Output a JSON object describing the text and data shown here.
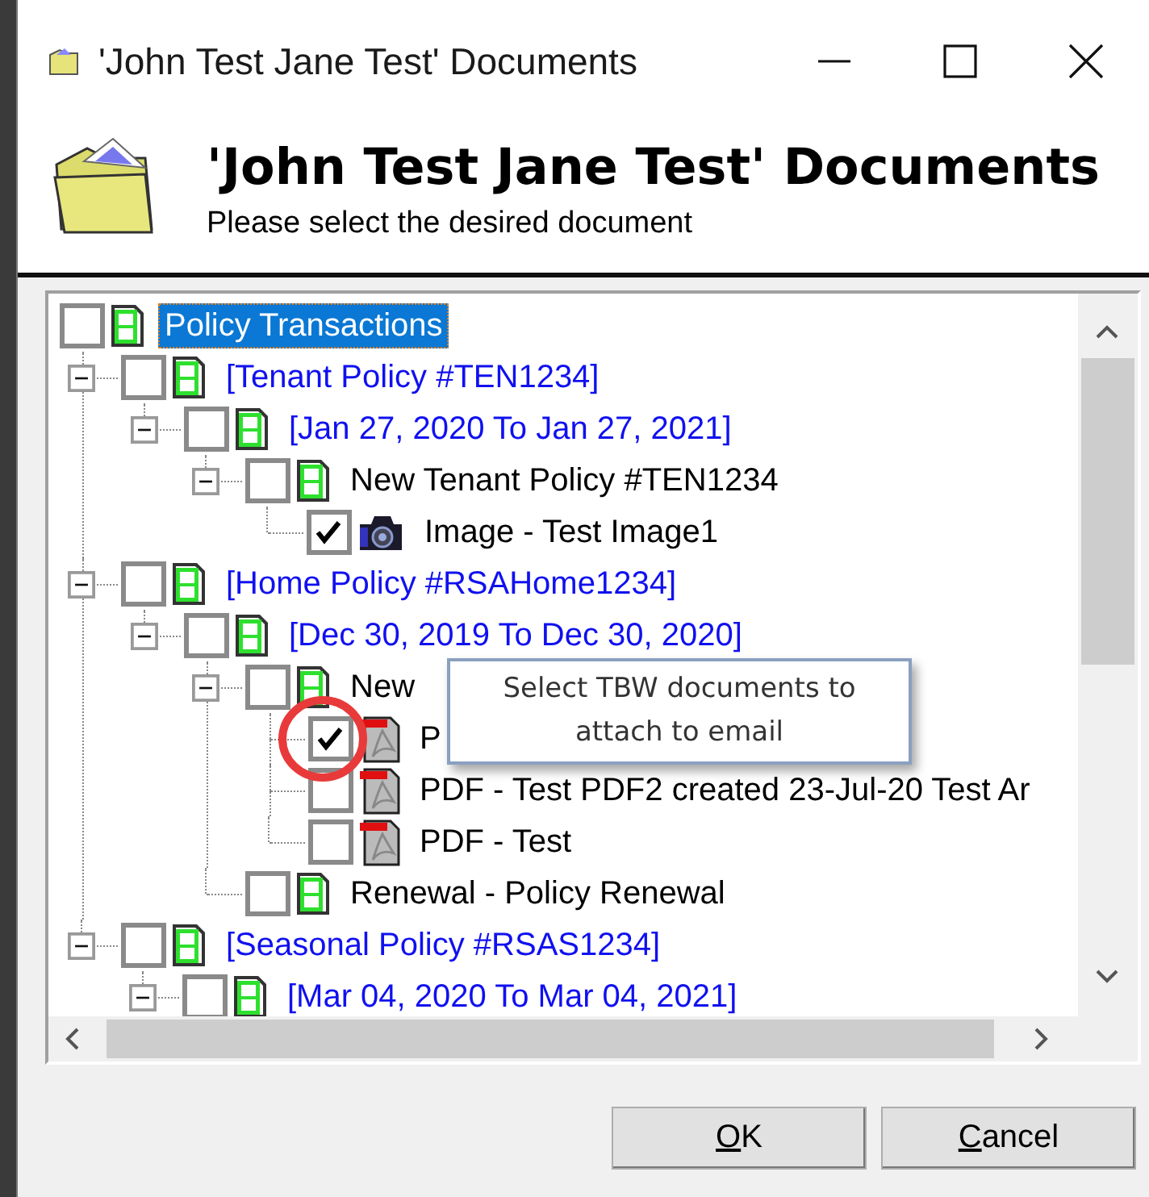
{
  "window": {
    "title": "'John Test Jane Test' Documents"
  },
  "header": {
    "title": "'John Test Jane Test' Documents",
    "subtitle": "Please select the desired document"
  },
  "tree": [
    {
      "label": "Policy Transactions",
      "kind": "group",
      "checked": false,
      "selected": true,
      "children": [
        {
          "label": "[Tenant Policy #TEN1234]",
          "kind": "group",
          "checked": false,
          "selected": false,
          "expanded": true,
          "children": [
            {
              "label": "[Jan 27, 2020 To Jan 27, 2021]",
              "kind": "group",
              "checked": false,
              "selected": false,
              "expanded": true,
              "children": [
                {
                  "label": "New Tenant Policy #TEN1234",
                  "kind": "transaction",
                  "checked": false,
                  "selected": false,
                  "expanded": true,
                  "children": [
                    {
                      "label": "Image - Test Image1",
                      "kind": "image",
                      "checked": true,
                      "selected": false
                    }
                  ]
                }
              ]
            }
          ]
        },
        {
          "label": "[Home Policy #RSAHome1234]",
          "kind": "group",
          "checked": false,
          "selected": false,
          "expanded": true,
          "children": [
            {
              "label": "[Dec 30, 2019 To Dec 30, 2020]",
              "kind": "group",
              "checked": false,
              "selected": false,
              "expanded": true,
              "children": [
                {
                  "label": "New",
                  "kind": "transaction",
                  "checked": false,
                  "selected": false,
                  "expanded": true,
                  "children": [
                    {
                      "label": "P",
                      "kind": "pdf",
                      "checked": true,
                      "selected": false
                    },
                    {
                      "label": "PDF - Test PDF2 created 23-Jul-20 Test Ar",
                      "kind": "pdf",
                      "checked": false,
                      "selected": false
                    },
                    {
                      "label": "PDF - Test",
                      "kind": "pdf",
                      "checked": false,
                      "selected": false
                    }
                  ]
                },
                {
                  "label": "Renewal - Policy Renewal",
                  "kind": "transaction",
                  "checked": false,
                  "selected": false
                }
              ]
            }
          ]
        },
        {
          "label": "[Seasonal Policy #RSAS1234]",
          "kind": "group",
          "checked": false,
          "selected": false,
          "expanded": true,
          "children": [
            {
              "label": "[Mar 04, 2020 To Mar 04, 2021]",
              "kind": "group",
              "checked": false,
              "selected": false,
              "expanded": true
            }
          ]
        }
      ]
    }
  ],
  "tooltip": {
    "text": "Select TBW documents to attach to email"
  },
  "buttons": [
    {
      "label": "OK",
      "underline_first": true
    },
    {
      "label": "Cancel",
      "underline_first": true
    }
  ]
}
